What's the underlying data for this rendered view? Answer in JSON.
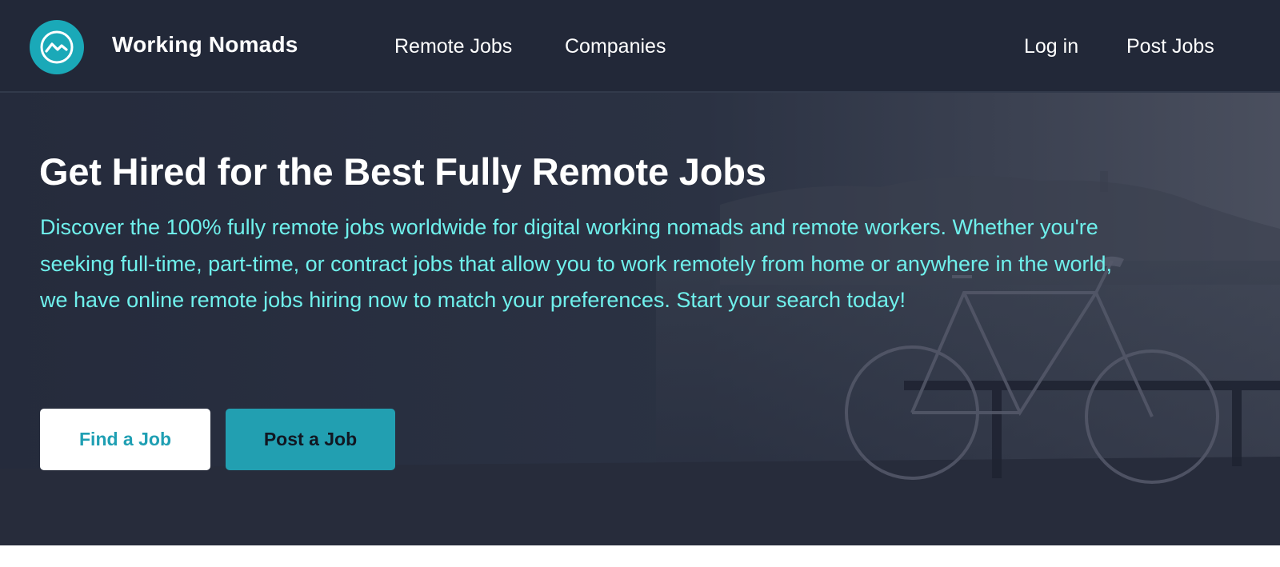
{
  "header": {
    "brand": "Working Nomads",
    "nav": {
      "remote_jobs": "Remote Jobs",
      "companies": "Companies",
      "login": "Log in",
      "post_jobs": "Post Jobs"
    },
    "logo_icon": "trend-line-icon"
  },
  "hero": {
    "title": "Get Hired for the Best Fully Remote Jobs",
    "description": "Discover the 100% fully remote jobs worldwide for digital working nomads and remote workers. Whether you're seeking full-time, part-time, or contract jobs that allow you to work remotely from home or anywhere in the world, we have online remote jobs hiring now to match your preferences. Start your search today!",
    "find_button": "Find a Job",
    "post_button": "Post a Job",
    "background_image": "bicycle-by-the-sea-photo"
  },
  "colors": {
    "header_bg": "#222838",
    "hero_bg": "#262c3d",
    "accent": "#1aa9b8",
    "description_text": "#6ff0ec",
    "post_button_bg": "#229fb1",
    "find_button_text": "#1f9fb3"
  }
}
